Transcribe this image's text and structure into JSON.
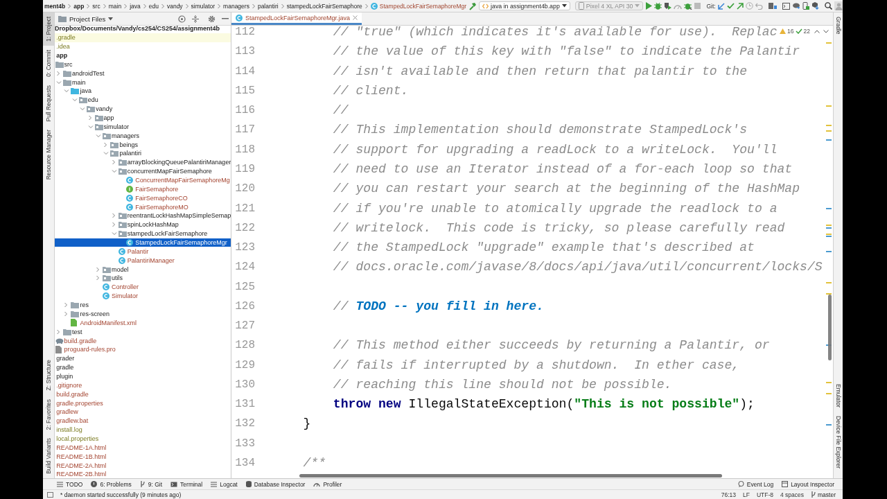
{
  "breadcrumbs": [
    {
      "text": "ment4b",
      "kind": "module"
    },
    {
      "text": "app",
      "kind": "module"
    },
    {
      "text": "src",
      "kind": "folder"
    },
    {
      "text": "main",
      "kind": "folder"
    },
    {
      "text": "java",
      "kind": "folder"
    },
    {
      "text": "edu",
      "kind": "folder"
    },
    {
      "text": "vandy",
      "kind": "folder"
    },
    {
      "text": "simulator",
      "kind": "folder"
    },
    {
      "text": "managers",
      "kind": "folder"
    },
    {
      "text": "palantiri",
      "kind": "folder"
    },
    {
      "text": "stampedLockFairSemaphore",
      "kind": "folder"
    },
    {
      "text": "StampedLockFairSemaphoreMgr",
      "kind": "class"
    }
  ],
  "toolbar": {
    "run_config": {
      "label": "java in assignment4b.app",
      "disabled": false
    },
    "device": {
      "label": "Pixel 4 XL API 30",
      "disabled": true
    },
    "git_label": "Git:"
  },
  "left_strip": [
    {
      "label": "1: Project",
      "selected": true
    },
    {
      "label": "0: Commit",
      "selected": false
    },
    {
      "label": "Pull Requests",
      "selected": false
    },
    {
      "label": "Resource Manager",
      "selected": false
    },
    {
      "label": "Z: Structure",
      "selected": false
    },
    {
      "label": "2: Favorites",
      "selected": false
    },
    {
      "label": "Build Variants",
      "selected": false
    }
  ],
  "right_strip": [
    {
      "label": "Gradle"
    },
    {
      "label": "Emulator"
    },
    {
      "label": "Device File Explorer"
    }
  ],
  "project_panel": {
    "title": "Project Files",
    "root": "Dropbox/Documents/Vandy/cs254/CS254/assignment4b",
    "items": [
      {
        "label": ".gradle",
        "unversioned": false,
        "ignored": true,
        "selected": false,
        "highlighted": true
      },
      {
        "label": ".idea",
        "unversioned": false,
        "ignored": true,
        "selected": false,
        "highlighted": false
      },
      {
        "label": "app",
        "kind": "module",
        "unversioned": false,
        "ignored": false,
        "selected": false,
        "highlighted": false,
        "children": [
          {
            "label": "src",
            "kind": "folder",
            "unversioned": false,
            "ignored": false,
            "selected": false,
            "highlighted": false,
            "children": [
              {
                "label": "androidTest",
                "kind": "folder",
                "expanded": false,
                "unversioned": false,
                "ignored": false,
                "selected": false,
                "highlighted": false
              },
              {
                "label": "main",
                "kind": "folder",
                "expanded": true,
                "unversioned": false,
                "ignored": false,
                "selected": false,
                "highlighted": false,
                "children": [
                  {
                    "label": "java",
                    "kind": "source",
                    "expanded": true,
                    "unversioned": false,
                    "ignored": false,
                    "selected": false,
                    "highlighted": false,
                    "children": [
                      {
                        "label": "edu",
                        "kind": "package",
                        "expanded": true,
                        "unversioned": false,
                        "ignored": false,
                        "selected": false,
                        "highlighted": false,
                        "children": [
                          {
                            "label": "vandy",
                            "kind": "package",
                            "expanded": true,
                            "unversioned": false,
                            "ignored": false,
                            "selected": false,
                            "highlighted": false,
                            "children": [
                              {
                                "label": "app",
                                "kind": "package",
                                "expanded": false,
                                "unversioned": false,
                                "ignored": false,
                                "selected": false,
                                "highlighted": false
                              },
                              {
                                "label": "simulator",
                                "kind": "package",
                                "expanded": true,
                                "unversioned": false,
                                "ignored": false,
                                "selected": false,
                                "highlighted": false,
                                "children": [
                                  {
                                    "label": "managers",
                                    "kind": "package",
                                    "expanded": true,
                                    "unversioned": false,
                                    "ignored": false,
                                    "selected": false,
                                    "highlighted": false,
                                    "children": [
                                      {
                                        "label": "beings",
                                        "kind": "package",
                                        "expanded": false,
                                        "unversioned": false,
                                        "ignored": false,
                                        "selected": false,
                                        "highlighted": false
                                      },
                                      {
                                        "label": "palantiri",
                                        "kind": "package",
                                        "expanded": true,
                                        "unversioned": false,
                                        "ignored": false,
                                        "selected": false,
                                        "highlighted": false,
                                        "children": [
                                          {
                                            "label": "arrayBlockingQueuePalantiriManager",
                                            "kind": "package",
                                            "expanded": false,
                                            "unversioned": false,
                                            "ignored": false,
                                            "selected": false,
                                            "highlighted": false
                                          },
                                          {
                                            "label": "concurrentMapFairSemaphore",
                                            "kind": "package",
                                            "expanded": true,
                                            "unversioned": false,
                                            "ignored": false,
                                            "selected": false,
                                            "highlighted": false,
                                            "children": [
                                              {
                                                "label": "ConcurrentMapFairSemaphoreMg",
                                                "kind": "class",
                                                "unversioned": true,
                                                "ignored": false,
                                                "selected": false,
                                                "highlighted": false
                                              },
                                              {
                                                "label": "FairSemaphore",
                                                "kind": "interface",
                                                "unversioned": true,
                                                "ignored": false,
                                                "selected": false,
                                                "highlighted": false
                                              },
                                              {
                                                "label": "FairSemaphoreCO",
                                                "kind": "class",
                                                "unversioned": true,
                                                "ignored": false,
                                                "selected": false,
                                                "highlighted": false
                                              },
                                              {
                                                "label": "FairSemaphoreMO",
                                                "kind": "class",
                                                "unversioned": true,
                                                "ignored": false,
                                                "selected": false,
                                                "highlighted": false
                                              }
                                            ]
                                          },
                                          {
                                            "label": "reentrantLockHashMapSimpleSemap",
                                            "kind": "package",
                                            "expanded": false,
                                            "unversioned": false,
                                            "ignored": false,
                                            "selected": false,
                                            "highlighted": false
                                          },
                                          {
                                            "label": "spinLockHashMap",
                                            "kind": "package",
                                            "expanded": false,
                                            "unversioned": false,
                                            "ignored": false,
                                            "selected": false,
                                            "highlighted": false
                                          },
                                          {
                                            "label": "stampedLockFairSemaphore",
                                            "kind": "package",
                                            "expanded": true,
                                            "unversioned": false,
                                            "ignored": false,
                                            "selected": false,
                                            "highlighted": false,
                                            "children": [
                                              {
                                                "label": "StampedLockFairSemaphoreMgr",
                                                "kind": "class",
                                                "unversioned": false,
                                                "ignored": false,
                                                "selected": true,
                                                "highlighted": false
                                              }
                                            ]
                                          },
                                          {
                                            "label": "Palantir",
                                            "kind": "class",
                                            "unversioned": true,
                                            "ignored": false,
                                            "selected": false,
                                            "highlighted": false
                                          },
                                          {
                                            "label": "PalantiriManager",
                                            "kind": "class",
                                            "unversioned": true,
                                            "ignored": false,
                                            "selected": false,
                                            "highlighted": false
                                          }
                                        ]
                                      }
                                    ]
                                  },
                                  {
                                    "label": "model",
                                    "kind": "package",
                                    "expanded": false,
                                    "unversioned": false,
                                    "ignored": false,
                                    "selected": false,
                                    "highlighted": false
                                  },
                                  {
                                    "label": "utils",
                                    "kind": "package",
                                    "expanded": false,
                                    "unversioned": false,
                                    "ignored": false,
                                    "selected": false,
                                    "highlighted": false
                                  },
                                  {
                                    "label": "Controller",
                                    "kind": "class",
                                    "unversioned": true,
                                    "ignored": false,
                                    "selected": false,
                                    "highlighted": false
                                  },
                                  {
                                    "label": "Simulator",
                                    "kind": "class",
                                    "unversioned": true,
                                    "ignored": false,
                                    "selected": false,
                                    "highlighted": false
                                  }
                                ]
                              }
                            ]
                          }
                        ]
                      }
                    ]
                  },
                  {
                    "label": "res",
                    "kind": "res",
                    "expanded": false,
                    "unversioned": false,
                    "ignored": false,
                    "selected": false,
                    "highlighted": false
                  },
                  {
                    "label": "res-screen",
                    "kind": "folder",
                    "expanded": false,
                    "unversioned": false,
                    "ignored": false,
                    "selected": false,
                    "highlighted": false
                  },
                  {
                    "label": "AndroidManifest.xml",
                    "kind": "manifest",
                    "unversioned": true,
                    "ignored": false,
                    "selected": false,
                    "highlighted": false
                  }
                ]
              },
              {
                "label": "test",
                "kind": "folder",
                "expanded": false,
                "unversioned": false,
                "ignored": false,
                "selected": false,
                "highlighted": false
              }
            ]
          },
          {
            "label": "build.gradle",
            "kind": "gradle",
            "unversioned": true,
            "ignored": false,
            "selected": false,
            "highlighted": false
          },
          {
            "label": "proguard-rules.pro",
            "kind": "text",
            "unversioned": true,
            "ignored": false,
            "selected": false,
            "highlighted": false
          }
        ]
      },
      {
        "label": "grader",
        "unversioned": false,
        "ignored": false,
        "selected": false,
        "highlighted": false
      },
      {
        "label": "gradle",
        "unversioned": false,
        "ignored": false,
        "selected": false,
        "highlighted": false
      },
      {
        "label": "plugin",
        "unversioned": false,
        "ignored": false,
        "selected": false,
        "highlighted": false
      },
      {
        "label": ".gitignore",
        "unversioned": true,
        "ignored": false,
        "selected": false,
        "highlighted": false
      },
      {
        "label": "build.gradle",
        "unversioned": true,
        "ignored": false,
        "selected": false,
        "highlighted": false
      },
      {
        "label": "gradle.properties",
        "unversioned": true,
        "ignored": false,
        "selected": false,
        "highlighted": false
      },
      {
        "label": "gradlew",
        "unversioned": true,
        "ignored": false,
        "selected": false,
        "highlighted": false
      },
      {
        "label": "gradlew.bat",
        "unversioned": true,
        "ignored": false,
        "selected": false,
        "highlighted": false
      },
      {
        "label": "install.log",
        "unversioned": false,
        "ignored": true,
        "selected": false,
        "highlighted": false
      },
      {
        "label": "local.properties",
        "unversioned": false,
        "ignored": true,
        "selected": false,
        "highlighted": false
      },
      {
        "label": "README-1A.html",
        "unversioned": true,
        "ignored": false,
        "selected": false,
        "highlighted": false
      },
      {
        "label": "README-1B.html",
        "unversioned": true,
        "ignored": false,
        "selected": false,
        "highlighted": false
      },
      {
        "label": "README-2A.html",
        "unversioned": true,
        "ignored": false,
        "selected": false,
        "highlighted": false
      },
      {
        "label": "README-2B.html",
        "unversioned": true,
        "ignored": false,
        "selected": false,
        "highlighted": false
      }
    ]
  },
  "editor": {
    "tabs": [
      {
        "label": "StampedLockFairSemaphoreMgr.java",
        "selected": true
      }
    ],
    "inspections": {
      "warnings": "16",
      "typos": "22"
    },
    "lines": [
      {
        "number": "112",
        "segments": [
          {
            "kind": "comment",
            "text": "        // \"true\" (which indicates it's available for use).  Replac"
          }
        ]
      },
      {
        "number": "113",
        "segments": [
          {
            "kind": "comment",
            "text": "        // the value of this key with \"false\" to indicate the Palantir"
          }
        ]
      },
      {
        "number": "114",
        "segments": [
          {
            "kind": "comment",
            "text": "        // isn't available and then return that palantir to the"
          }
        ]
      },
      {
        "number": "115",
        "segments": [
          {
            "kind": "comment",
            "text": "        // client."
          }
        ]
      },
      {
        "number": "116",
        "segments": [
          {
            "kind": "comment",
            "text": "        //"
          }
        ]
      },
      {
        "number": "117",
        "segments": [
          {
            "kind": "comment",
            "text": "        // This implementation should demonstrate StampedLock's"
          }
        ]
      },
      {
        "number": "118",
        "segments": [
          {
            "kind": "comment",
            "text": "        // support for upgrading a readLock to a writeLock.  You'll"
          }
        ]
      },
      {
        "number": "119",
        "segments": [
          {
            "kind": "comment",
            "text": "        // need to use an Iterator instead of a for-each loop so that"
          }
        ]
      },
      {
        "number": "120",
        "segments": [
          {
            "kind": "comment",
            "text": "        // you can restart your search at the beginning of the HashMap"
          }
        ]
      },
      {
        "number": "121",
        "segments": [
          {
            "kind": "comment",
            "text": "        // if you're unable to atomically upgrade the readlock to a"
          }
        ]
      },
      {
        "number": "122",
        "segments": [
          {
            "kind": "comment",
            "text": "        // writelock.  This code is tricky, so please carefully read"
          }
        ]
      },
      {
        "number": "123",
        "segments": [
          {
            "kind": "comment",
            "text": "        // the StampedLock \"upgrade\" example that's described at"
          }
        ]
      },
      {
        "number": "124",
        "segments": [
          {
            "kind": "comment",
            "text": "        // docs.oracle.com/javase/8/docs/api/java/util/concurrent/locks/S"
          }
        ]
      },
      {
        "number": "125"
      },
      {
        "number": "126",
        "segments": [
          {
            "kind": "comment",
            "text": "        // "
          },
          {
            "kind": "todo",
            "text": "TODO -- you fill in here."
          }
        ]
      },
      {
        "number": "127"
      },
      {
        "number": "128",
        "segments": [
          {
            "kind": "comment",
            "text": "        // This method either succeeds by returning a Palantir, or"
          }
        ]
      },
      {
        "number": "129",
        "segments": [
          {
            "kind": "comment",
            "text": "        // fails if interrupted by a shutdown.  In ether case,"
          }
        ]
      },
      {
        "number": "130",
        "segments": [
          {
            "kind": "comment",
            "text": "        // reaching this line should not be possible."
          }
        ]
      },
      {
        "number": "131",
        "segments": [
          {
            "kind": "keyword",
            "text": "        throw new"
          },
          {
            "kind": "plain",
            "text": " IllegalStateException("
          },
          {
            "kind": "string",
            "text": "\"This is not possible\""
          },
          {
            "kind": "plain",
            "text": ");"
          }
        ]
      },
      {
        "number": "132",
        "segments": [
          {
            "kind": "plain",
            "text": "    }"
          }
        ]
      },
      {
        "number": "133"
      },
      {
        "number": "134",
        "segments": [
          {
            "kind": "comment",
            "text": "    /**"
          }
        ]
      }
    ]
  },
  "tool_windows": {
    "left": [
      {
        "label": "TODO"
      },
      {
        "label": "6: Problems"
      },
      {
        "label": "9: Git"
      },
      {
        "label": "Terminal"
      },
      {
        "label": "Logcat"
      },
      {
        "label": "Database Inspector"
      },
      {
        "label": "Profiler"
      }
    ],
    "right": [
      {
        "label": "Event Log"
      },
      {
        "label": "Layout Inspector"
      }
    ]
  },
  "status_bar": {
    "message": "* daemon started successfully (9 minutes ago)",
    "items": [
      "76:13",
      "LF",
      "UTF-8",
      "4 spaces",
      "master"
    ]
  }
}
